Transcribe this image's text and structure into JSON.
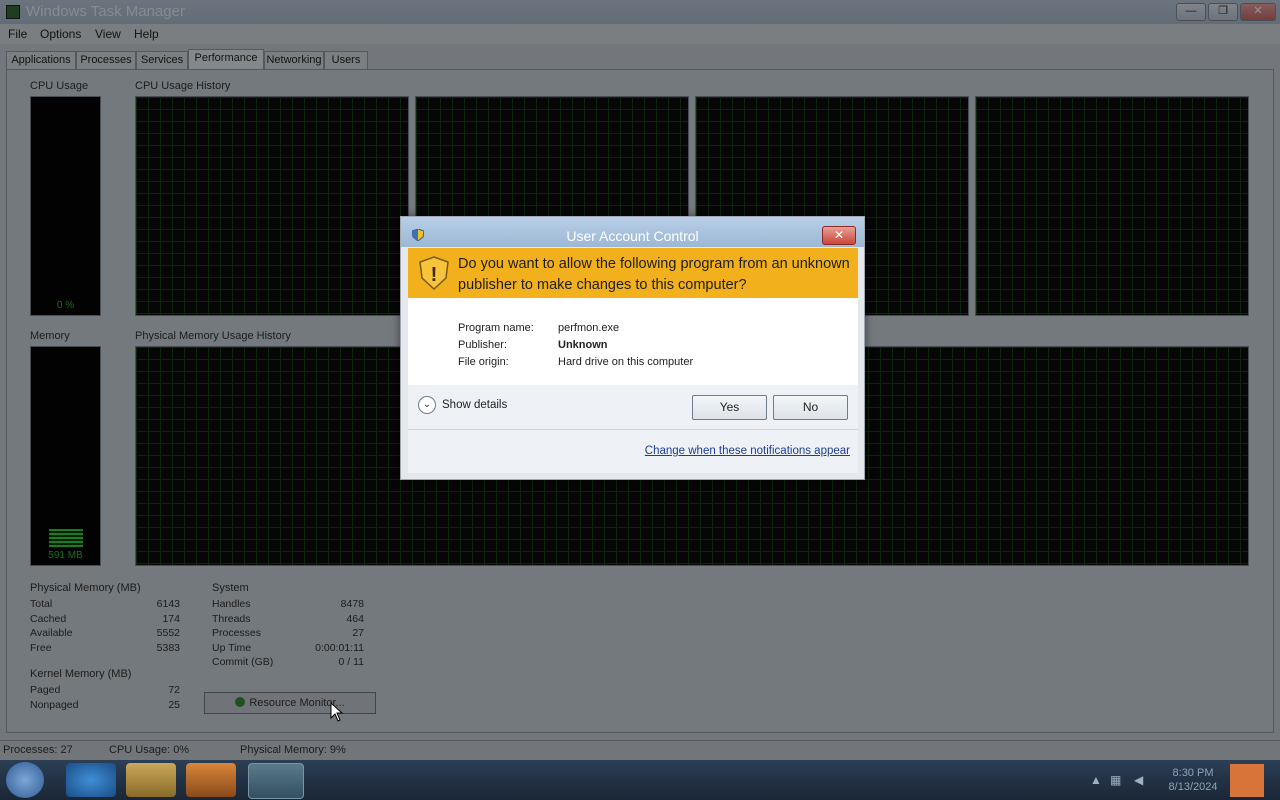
{
  "window": {
    "title": "Windows Task Manager",
    "controls": {
      "minimize": "—",
      "maximize": "❐",
      "close": "✕"
    }
  },
  "menu": [
    "File",
    "Options",
    "View",
    "Help"
  ],
  "tabs": [
    {
      "label": "Applications"
    },
    {
      "label": "Processes"
    },
    {
      "label": "Services"
    },
    {
      "label": "Performance",
      "active": true
    },
    {
      "label": "Networking"
    },
    {
      "label": "Users"
    }
  ],
  "performance": {
    "cpu_usage_label": "CPU Usage",
    "cpu_usage_value": "0 %",
    "cpu_history_label": "CPU Usage History",
    "memory_label": "Memory",
    "memory_value": "591 MB",
    "memory_history_label": "Physical Memory Usage History",
    "physical_memory": {
      "heading": "Physical Memory (MB)",
      "rows": [
        {
          "label": "Total",
          "value": "6143"
        },
        {
          "label": "Cached",
          "value": "174"
        },
        {
          "label": "Available",
          "value": "5552"
        },
        {
          "label": "Free",
          "value": "5383"
        }
      ]
    },
    "kernel_memory": {
      "heading": "Kernel Memory (MB)",
      "rows": [
        {
          "label": "Paged",
          "value": "72"
        },
        {
          "label": "Nonpaged",
          "value": "25"
        }
      ]
    },
    "system": {
      "heading": "System",
      "rows": [
        {
          "label": "Handles",
          "value": "8478"
        },
        {
          "label": "Threads",
          "value": "464"
        },
        {
          "label": "Processes",
          "value": "27"
        },
        {
          "label": "Up Time",
          "value": "0:00:01:11"
        },
        {
          "label": "Commit (GB)",
          "value": "0 / 11"
        }
      ]
    },
    "resource_monitor_label": "Resource Monitor..."
  },
  "statusbar": {
    "processes": "Processes: 27",
    "cpu": "CPU Usage: 0%",
    "memory": "Physical Memory: 9%"
  },
  "uac": {
    "title": "User Account Control",
    "question": "Do you want to allow the following program from an unknown publisher to make changes to this computer?",
    "program_name_label": "Program name:",
    "program_name": "perfmon.exe",
    "publisher_label": "Publisher:",
    "publisher": "Unknown",
    "file_origin_label": "File origin:",
    "file_origin": "Hard drive on this computer",
    "show_details": "Show details",
    "yes": "Yes",
    "no": "No",
    "change_link": "Change when these notifications appear",
    "banner_color": "#f2b01c"
  },
  "taskbar": {
    "clock_time": "8:30 PM",
    "clock_date": "8/13/2024"
  }
}
